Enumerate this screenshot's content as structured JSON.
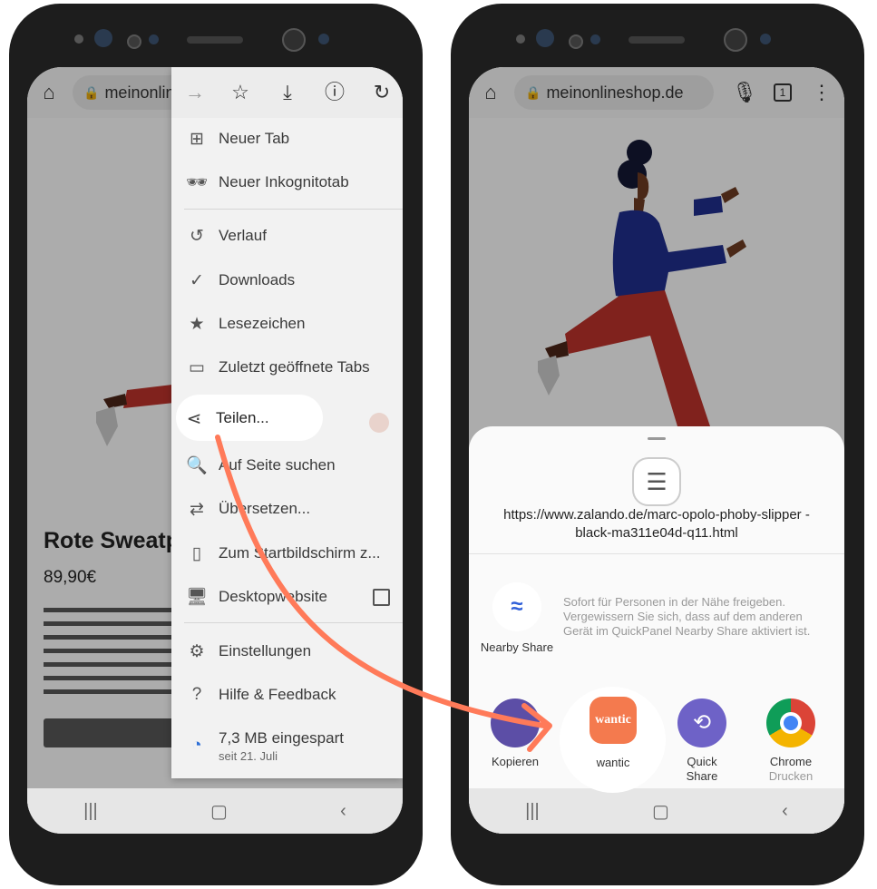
{
  "left_phone": {
    "url": "meinonline",
    "product": {
      "title": "Rote Sweatp",
      "price": "89,90€"
    },
    "menu": {
      "toolbar_icons": [
        "forward-icon",
        "star-icon",
        "download-icon",
        "info-icon",
        "reload-icon"
      ],
      "items": [
        {
          "label": "Neuer Tab",
          "icon": "new-tab-icon"
        },
        {
          "label": "Neuer Inkognitotab",
          "icon": "incognito-icon"
        },
        {
          "label": "Verlauf",
          "icon": "history-icon"
        },
        {
          "label": "Downloads",
          "icon": "downloads-icon"
        },
        {
          "label": "Lesezeichen",
          "icon": "bookmark-star-icon"
        },
        {
          "label": "Zuletzt geöffnete Tabs",
          "icon": "recent-tabs-icon"
        },
        {
          "label": "Teilen...",
          "icon": "share-icon"
        },
        {
          "label": "Auf Seite suchen",
          "icon": "find-in-page-icon"
        },
        {
          "label": "Übersetzen...",
          "icon": "translate-icon"
        },
        {
          "label": "Zum Startbildschirm z...",
          "icon": "add-to-home-icon"
        },
        {
          "label": "Desktopwebsite",
          "icon": "desktop-icon"
        },
        {
          "label": "Einstellungen",
          "icon": "settings-gear-icon"
        },
        {
          "label": "Hilfe & Feedback",
          "icon": "help-icon"
        }
      ],
      "savings": {
        "amount": "7,3 MB eingespart",
        "since": "seit 21. Juli"
      }
    }
  },
  "right_phone": {
    "url": "meinonlineshop.de",
    "tab_count": "1",
    "share_sheet": {
      "link": "https://www.zalando.de/marc-opolo-phoby-slipper -black-ma311e04d-q11.html",
      "nearby": {
        "label": "Nearby Share",
        "description": "Sofort für Personen in der Nähe freigeben. Vergewissern Sie sich, dass auf dem anderen Gerät im QuickPanel Nearby Share aktiviert ist."
      },
      "apps": [
        {
          "label": "Kopieren",
          "sublabel": ""
        },
        {
          "label": "wantic",
          "sublabel": ""
        },
        {
          "label": "Quick Share",
          "sublabel": ""
        },
        {
          "label": "Chrome",
          "sublabel": "Drucken"
        }
      ],
      "wantic_logo": "wantic"
    }
  },
  "colors": {
    "accent_orange": "#ff7a59",
    "wantic_orange": "#f47a4e",
    "quickshare_purple": "#6e62c7",
    "nearby_blue": "#2f5fd8"
  }
}
